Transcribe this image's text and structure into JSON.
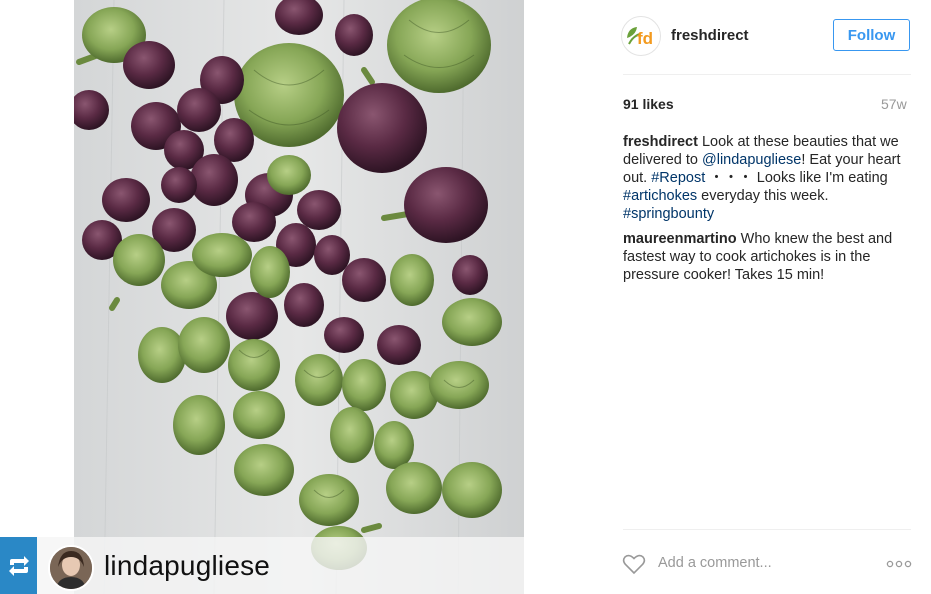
{
  "post": {
    "username": "freshdirect",
    "follow_label": "Follow",
    "likes": "91 likes",
    "age": "57w",
    "caption": {
      "user": "freshdirect",
      "text_1": " Look at these beauties that we delivered to ",
      "mention": "@lindapugliese",
      "text_2": "! Eat your heart out. ",
      "tag_repost": "#Repost",
      "text_3": " ・・・ Looks like I'm eating ",
      "tag_artichokes": "#artichokes",
      "text_4": " everyday this week. ",
      "tag_springbounty": "#springbounty"
    },
    "comments": [
      {
        "user": "maureenmartino",
        "text": " Who knew the best and fastest way to cook artichokes is in the pressure cooker! Takes 15 min!"
      }
    ],
    "add_comment_placeholder": "Add a comment...",
    "logo_text": "fd"
  },
  "photo": {
    "repost_user": "lindapugliese",
    "repost_badge_color": "#2a88c6",
    "background_color": "#dfe1e1",
    "artichoke_green": "#8fae5e",
    "artichoke_purple": "#5b2d47"
  },
  "icons": {
    "repost": "repost-icon",
    "heart": "heart-icon",
    "more": "more-options-icon"
  },
  "colors": {
    "follow_blue": "#3897f0",
    "link_blue": "#003569",
    "logo_green": "#6aa13a",
    "logo_orange": "#f39a1e"
  }
}
